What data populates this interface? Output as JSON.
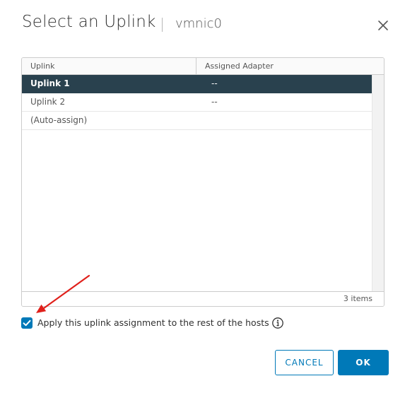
{
  "dialog": {
    "title": "Select an Uplink",
    "subtitle": "vmnic0",
    "close_icon": "close-icon"
  },
  "grid": {
    "columns": [
      "Uplink",
      "Assigned Adapter"
    ],
    "rows": [
      {
        "uplink": "Uplink 1",
        "adapter": "--",
        "selected": true
      },
      {
        "uplink": "Uplink 2",
        "adapter": "--",
        "selected": false
      },
      {
        "uplink": "(Auto-assign)",
        "adapter": "",
        "selected": false
      }
    ],
    "item_count": "3 items"
  },
  "apply_option": {
    "label": "Apply this uplink assignment to the rest of the hosts",
    "checked": true,
    "info_icon": "info-icon"
  },
  "buttons": {
    "cancel": "CANCEL",
    "ok": "OK"
  },
  "colors": {
    "primary": "#0079b8",
    "selected_row": "#29414e",
    "annotation_arrow": "#e0201b"
  }
}
